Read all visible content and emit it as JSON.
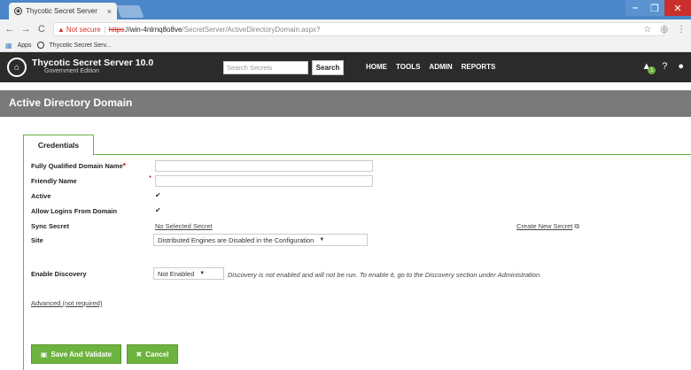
{
  "browser": {
    "tab_title": "Thycotic Secret Server",
    "tab_close": "×",
    "url_not_secure": "Not secure",
    "url_scheme": "https",
    "url_host": "://win-4nlrnq8o8ve",
    "url_path": "/SecretServer/ActiveDirectoryDomain.aspx?",
    "bookmarks": [
      "Apps",
      "Thycotic Secret Serv..."
    ]
  },
  "header": {
    "brand_title": "Thycotic Secret Server 10.0",
    "brand_sub": "Government Edition",
    "search_placeholder": "Search Secrets",
    "search_button": "Search",
    "nav": [
      "HOME",
      "TOOLS",
      "ADMIN",
      "REPORTS"
    ],
    "alert_count": "1"
  },
  "page": {
    "title": "Active Directory Domain"
  },
  "form": {
    "tab_label": "Credentials",
    "fqdn_label": "Fully Qualified Domain Name",
    "friendly_label": "Friendly Name",
    "active_label": "Active",
    "allow_logins_label": "Allow Logins From Domain",
    "sync_secret_label": "Sync Secret",
    "sync_secret_value": "No Selected Secret",
    "create_secret_link": "Create New Secret",
    "site_label": "Site",
    "site_value": "Distributed Engines are Disabled in the Configuration",
    "discovery_label": "Enable Discovery",
    "discovery_value": "Not Enabled",
    "discovery_note": "Discovery is not enabled and will not be run. To enable it, go to the Discovery section under Administration.",
    "advanced_link": "Advanced (not required)",
    "save_button": "Save And Validate",
    "cancel_button": "Cancel",
    "required_mark": "*",
    "check_mark": "✔"
  },
  "colors": {
    "accent": "#6db33f",
    "header_bg": "#2b2b2b",
    "title_bar": "#7a7a7a",
    "chrome_blue": "#4a86c8"
  }
}
